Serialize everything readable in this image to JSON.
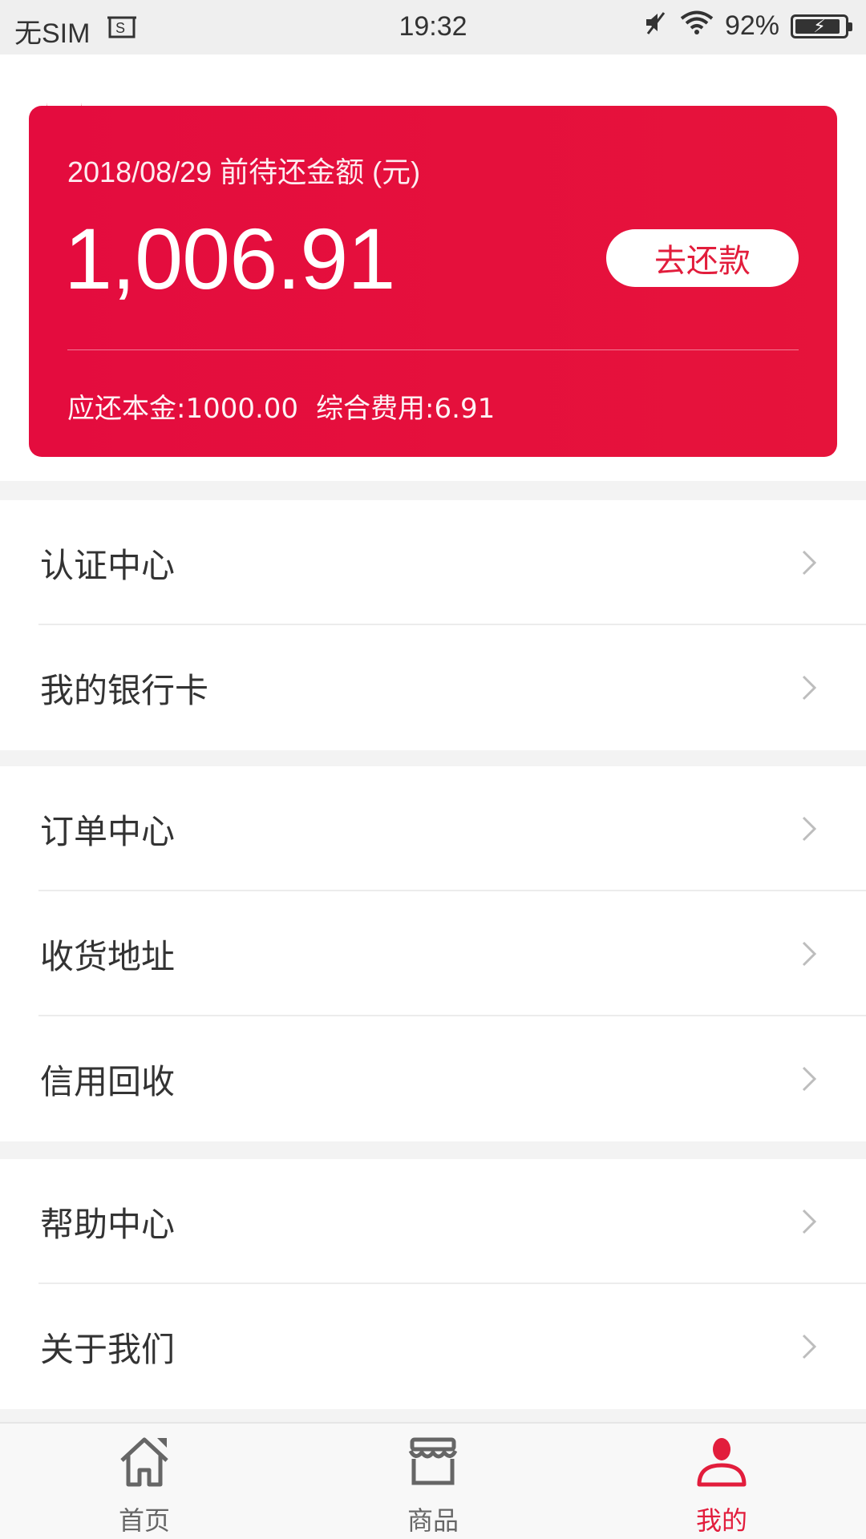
{
  "status_bar": {
    "carrier": "无SIM",
    "time": "19:32",
    "battery_text": "92%",
    "battery_level": 0.92
  },
  "repayment_card": {
    "date_label": "2018/08/29 前待还金额 (元)",
    "amount": "1,006.91",
    "repay_button": "去还款",
    "principal": "应还本金:1000.00",
    "fees": "综合费用:6.91",
    "colors": {
      "background": "#e40c3e",
      "button_text": "#e21d3c"
    }
  },
  "menu": {
    "group1": [
      {
        "label": "认证中心"
      },
      {
        "label": "我的银行卡"
      }
    ],
    "group2": [
      {
        "label": "订单中心"
      },
      {
        "label": "收货地址"
      },
      {
        "label": "信用回收"
      }
    ],
    "group3": [
      {
        "label": "帮助中心"
      },
      {
        "label": "关于我们"
      }
    ]
  },
  "tabbar": {
    "tabs": [
      {
        "label": "首页",
        "icon": "home-icon",
        "active": false
      },
      {
        "label": "商品",
        "icon": "store-icon",
        "active": false
      },
      {
        "label": "我的",
        "icon": "user-icon",
        "active": true
      }
    ],
    "active_color": "#e21d3c"
  }
}
